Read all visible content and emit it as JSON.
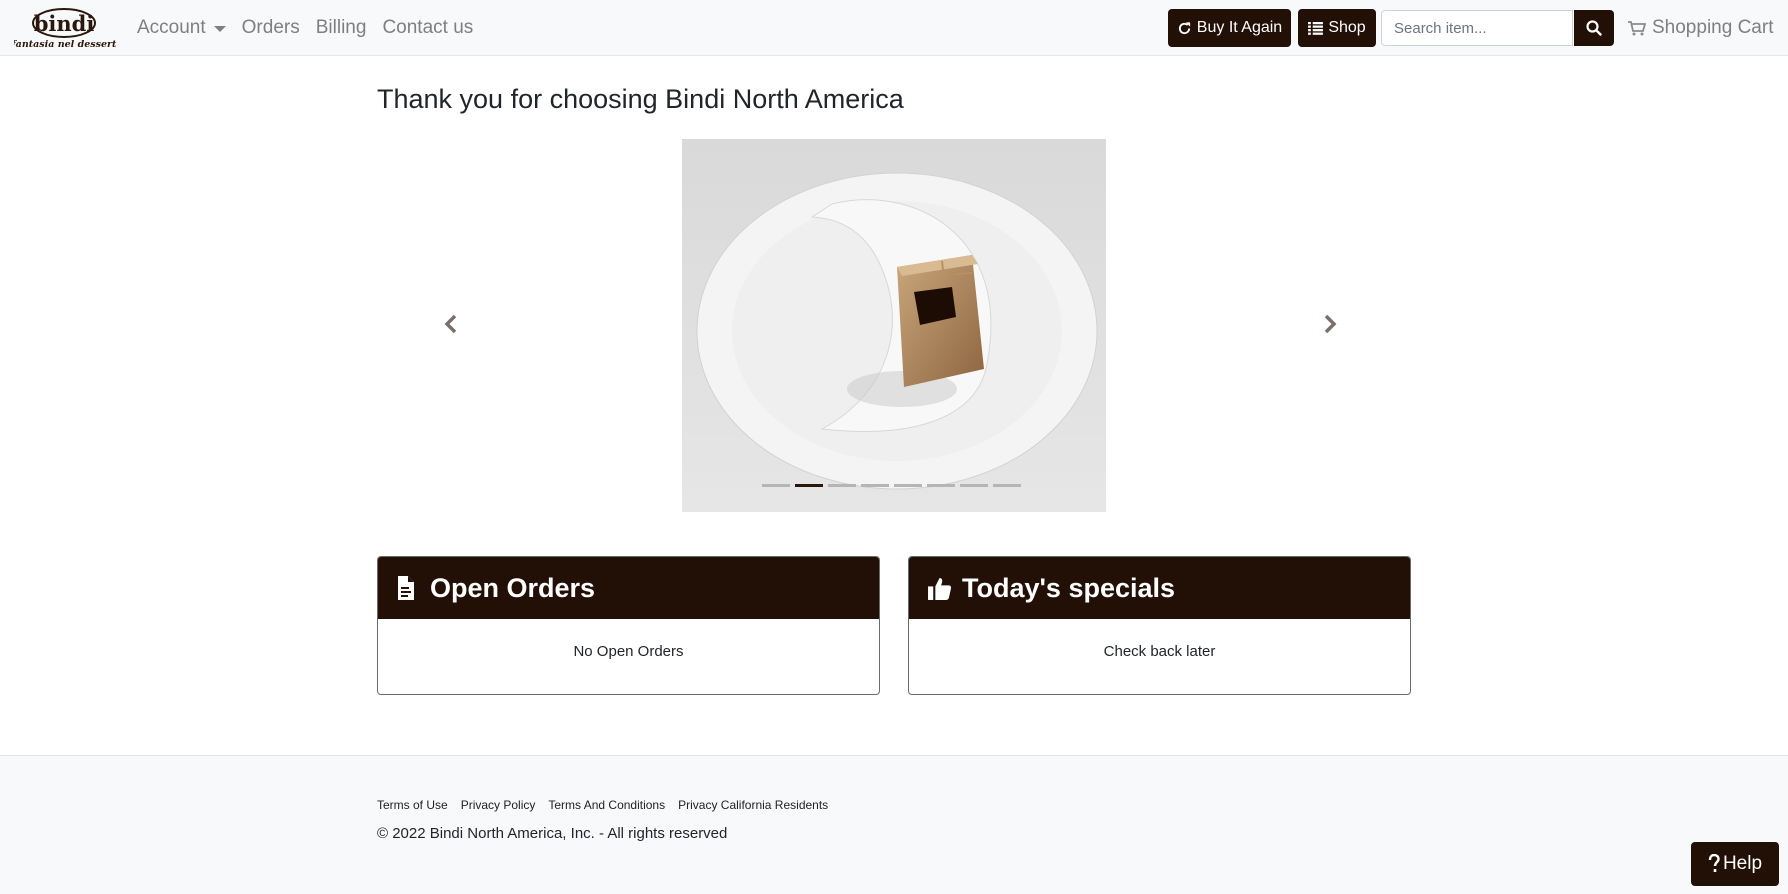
{
  "brand": {
    "name": "bindi",
    "tagline": "fantasia nel dessert"
  },
  "nav": {
    "account": "Account",
    "orders": "Orders",
    "billing": "Billing",
    "contact": "Contact us",
    "buy_again": "Buy It Again",
    "shop": "Shop",
    "search_placeholder": "Search item...",
    "cart": "Shopping Cart"
  },
  "main": {
    "title": "Thank you for choosing Bindi North America",
    "carousel": {
      "slides": 8,
      "active_index": 1
    }
  },
  "cards": {
    "open_orders": {
      "title": "Open Orders",
      "body": "No Open Orders"
    },
    "specials": {
      "title": "Today's specials",
      "body": "Check back later"
    }
  },
  "footer": {
    "links": [
      "Terms of Use",
      "Privacy Policy",
      "Terms And Conditions",
      "Privacy California Residents"
    ],
    "copyright": "© 2022 Bindi North America, Inc. - All rights reserved"
  },
  "help": "Help",
  "colors": {
    "primary": "#220f05",
    "nav_bg": "#f8f9fa",
    "nav_text": "#7f7f7f"
  },
  "icons": [
    "refresh-icon",
    "list-icon",
    "search-icon",
    "cart-icon",
    "chevron-left-icon",
    "chevron-right-icon",
    "document-icon",
    "thumbs-up-icon",
    "question-icon"
  ]
}
